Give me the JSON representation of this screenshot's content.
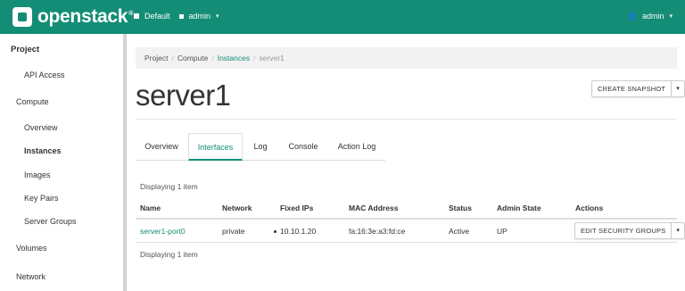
{
  "navbar": {
    "brand": "openstack",
    "brand_mark": "®",
    "domain": "Default",
    "project": "admin",
    "user": "admin",
    "caret": "▾",
    "bg_color": "#138d75"
  },
  "sidebar": {
    "project": "Project",
    "api_access": "API Access",
    "compute": "Compute",
    "overview": "Overview",
    "instances": "Instances",
    "images": "Images",
    "key_pairs": "Key Pairs",
    "server_groups": "Server Groups",
    "volumes": "Volumes",
    "network": "Network"
  },
  "breadcrumb": {
    "project": "Project",
    "compute": "Compute",
    "instances": "Instances",
    "current": "server1",
    "separator": "/"
  },
  "page": {
    "title": "server1",
    "create_snapshot": "CREATE SNAPSHOT",
    "caret": "▾"
  },
  "tabs": {
    "overview": "Overview",
    "interfaces": "Interfaces",
    "log": "Log",
    "console": "Console",
    "action_log": "Action Log"
  },
  "table": {
    "display_count": "Displaying 1 item",
    "columns": {
      "name": "Name",
      "network": "Network",
      "fixed_ips": "Fixed IPs",
      "mac": "MAC Address",
      "status": "Status",
      "admin_state": "Admin State",
      "actions": "Actions"
    },
    "rows": [
      {
        "name": "server1-port0",
        "network": "private",
        "fixed_ip": "10.10.1.20",
        "mac": "fa:16:3e:a3:fd:ce",
        "status": "Active",
        "admin_state": "UP",
        "action": "EDIT SECURITY GROUPS"
      }
    ]
  }
}
